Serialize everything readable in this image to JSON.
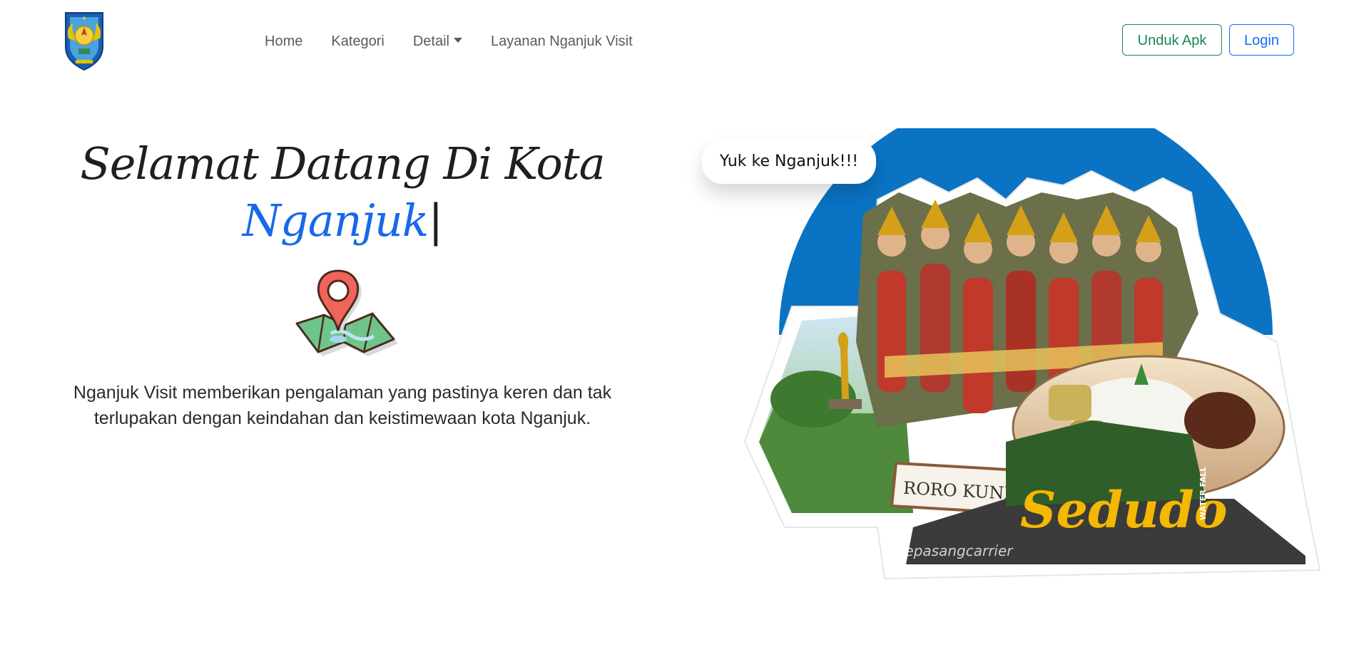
{
  "navbar": {
    "logo_icon": "nganjuk-regency-emblem",
    "links": [
      "Home",
      "Kategori",
      "Detail",
      "Layanan Nganjuk Visit"
    ],
    "download_button": "Unduk Apk",
    "login_button": "Login"
  },
  "hero": {
    "title_line1": "Selamat Datang Di Kota",
    "title_highlight": "Nganjuk",
    "title_cursor": "|",
    "map_icon": "map-pin-icon",
    "description": "Nganjuk Visit memberikan pengalaman yang pastinya keren dan tak terlupakan dengan keindahan dan keistimewaan kota Nganjuk."
  },
  "collage": {
    "bubble_text": "Yuk ke Nganjuk!!!",
    "sign_roro": "RORO KUNING",
    "sign_sedudo": "Sedudo",
    "sign_waterfall": "WATER FALL",
    "watermark": "sepasangcarrier"
  },
  "colors": {
    "accent_blue": "#1769e8",
    "login_blue": "#0d6efd",
    "download_green": "#198754",
    "collage_circle": "#0a73c4"
  }
}
